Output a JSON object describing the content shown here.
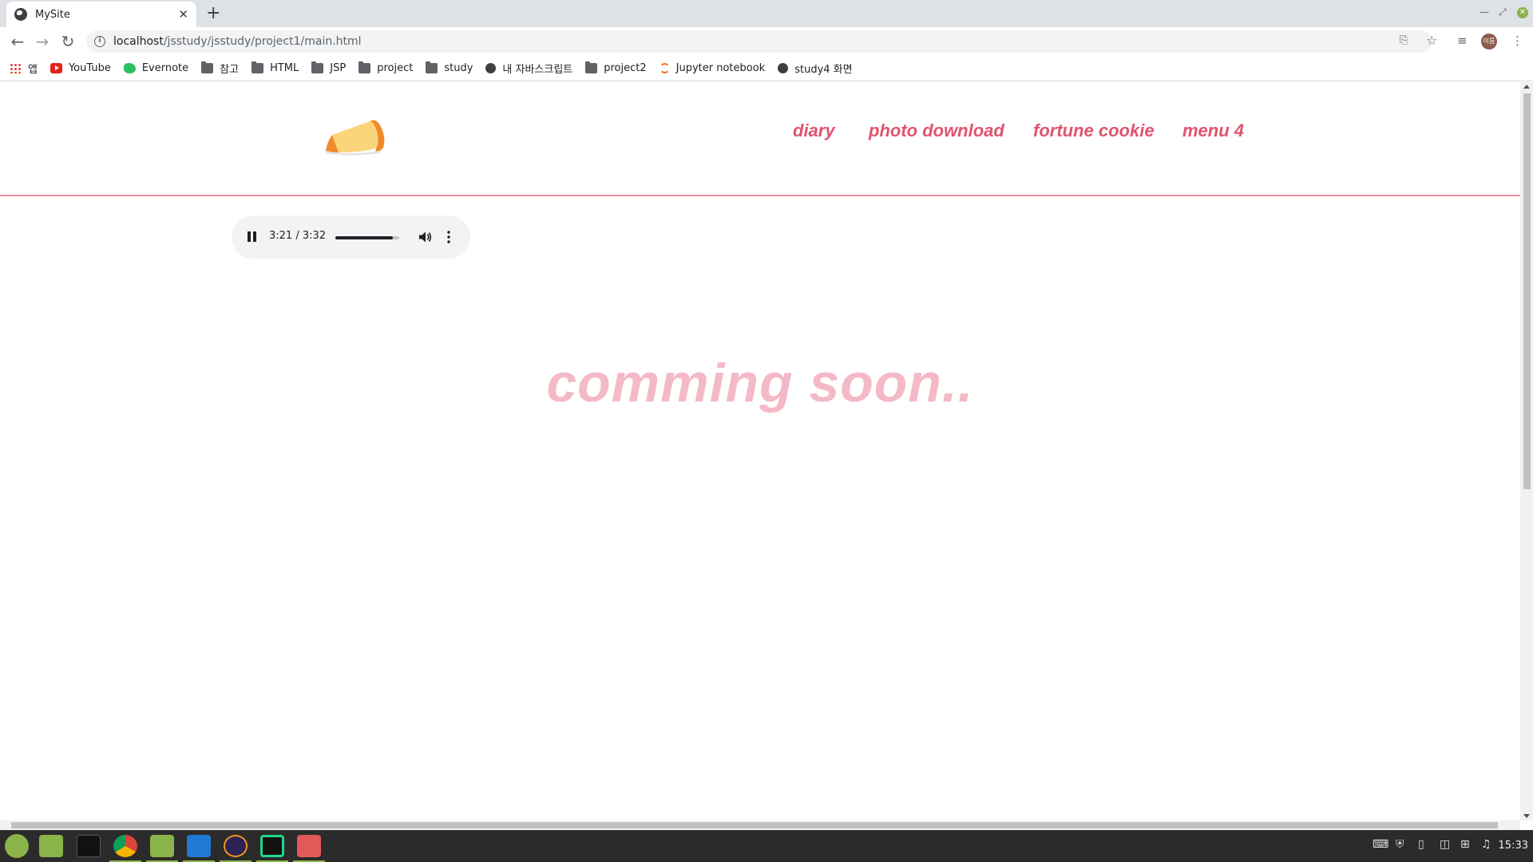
{
  "browser": {
    "tab": {
      "title": "MySite",
      "close": "✕"
    },
    "new_tab": "+",
    "address": {
      "host": "localhost",
      "path": "/jsstudy/jsstudy/project1/main.html"
    },
    "profile_label": "이름",
    "bookmarks": [
      {
        "label": "앱",
        "icon": "apps-icon"
      },
      {
        "label": "YouTube",
        "icon": "youtube-icon"
      },
      {
        "label": "Evernote",
        "icon": "evernote-icon"
      },
      {
        "label": "참고",
        "icon": "folder-icon"
      },
      {
        "label": "HTML",
        "icon": "folder-icon"
      },
      {
        "label": "JSP",
        "icon": "folder-icon"
      },
      {
        "label": "project",
        "icon": "folder-icon"
      },
      {
        "label": "study",
        "icon": "folder-icon"
      },
      {
        "label": "내 자바스크립트",
        "icon": "globe-icon"
      },
      {
        "label": "project2",
        "icon": "folder-icon"
      },
      {
        "label": "Jupyter notebook",
        "icon": "jupyter-icon"
      },
      {
        "label": "study4 화면",
        "icon": "globe-icon"
      }
    ]
  },
  "site": {
    "nav": [
      "diary",
      "photo download",
      "fortune cookie",
      "menu 4"
    ],
    "audio": {
      "time": "3:21 / 3:32",
      "volume_level": 0.9
    },
    "message": "comming soon.."
  },
  "taskbar": {
    "apps": [
      "mint-menu-icon",
      "file-manager-icon",
      "terminal-icon",
      "chrome-icon",
      "files-icon",
      "vscode-icon",
      "eclipse-icon",
      "pycharm-icon",
      "viewer-icon"
    ],
    "clock": "15:33"
  },
  "colors": {
    "accent": "#e0536d",
    "soon": "#f4b9c6",
    "divider": "#ee8fa2",
    "taskbar": "#2b2b2b"
  }
}
